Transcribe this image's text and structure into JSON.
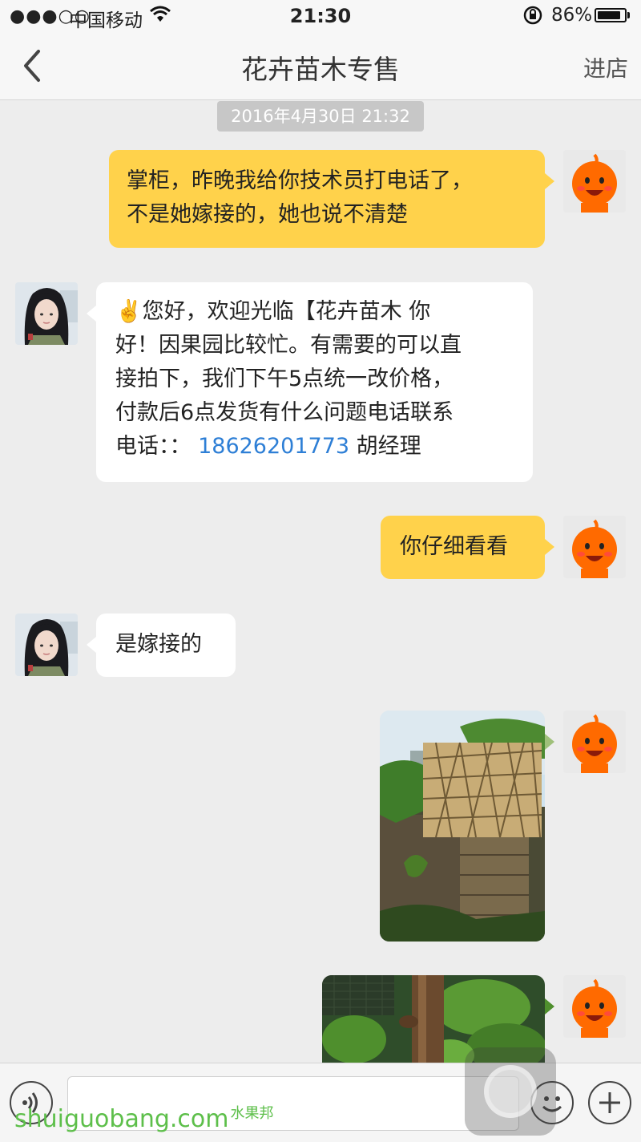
{
  "status_bar": {
    "signal": "●●●○○",
    "carrier": "中国移动",
    "time": "21:30",
    "battery_percent": "86%",
    "battery_level": 0.86
  },
  "nav": {
    "title": "花卉苗木专售",
    "shop_label": "进店"
  },
  "timestamp": "2016年4月30日 21:32",
  "messages": [
    {
      "from": "me",
      "type": "text",
      "lines": [
        "掌柜，昨晚我给你技术员打电话了，",
        "不是她嫁接的，她也说不清楚"
      ]
    },
    {
      "from": "shop",
      "type": "text",
      "lines": [
        "✌️您好，欢迎光临【花卉苗木 你",
        "好！因果园比较忙。有需要的可以直",
        "接拍下，我们下午5点统一改价格，",
        "付款后6点发货有什么问题电话联系"
      ],
      "last_prefix": "电话：：",
      "phone": "18626201773",
      "last_suffix": " 胡经理"
    },
    {
      "from": "me",
      "type": "text",
      "lines": [
        "你仔细看看"
      ]
    },
    {
      "from": "shop",
      "type": "text",
      "lines": [
        "是嫁接的"
      ]
    },
    {
      "from": "me",
      "type": "image",
      "description": "photo-grafted-tree-box"
    },
    {
      "from": "me",
      "type": "image",
      "description": "photo-tree-trunk"
    }
  ],
  "input": {
    "value": "",
    "placeholder": ""
  },
  "watermark": {
    "text": "shuiguobang",
    "suffix": ".com",
    "small": "水果邦"
  },
  "colors": {
    "my_bubble": "#ffd24b",
    "their_bubble": "#ffffff",
    "link": "#2e7fd6",
    "background": "#ededed"
  },
  "icons": [
    "wifi-icon",
    "lock-rotation-icon",
    "battery-icon",
    "back-chevron-icon",
    "voice-icon",
    "emoji-icon",
    "plus-icon"
  ]
}
